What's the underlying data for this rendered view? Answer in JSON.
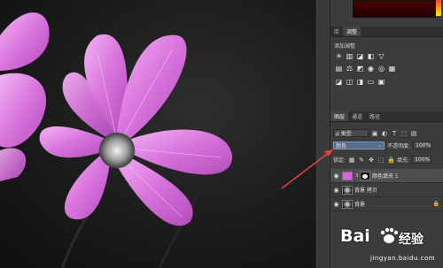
{
  "adjustments_panel": {
    "tabs": [
      "库",
      "调整"
    ],
    "active_tab": "调整",
    "title": "添加调整"
  },
  "layers_panel": {
    "tabs": [
      "图层",
      "通道",
      "路径"
    ],
    "active_tab": "图层",
    "kind_filter": "ρ 类型",
    "blend_mode": "颜色",
    "opacity_label": "不透明度:",
    "opacity_value": "100%",
    "lock_label": "锁定:",
    "fill_label": "填充:",
    "fill_value": "100%",
    "layers": [
      {
        "name": "颜色填充 1",
        "type": "fill",
        "selected": true
      },
      {
        "name": "背景 拷贝",
        "type": "photo-mask",
        "selected": false
      },
      {
        "name": "背景",
        "type": "photo",
        "selected": false
      }
    ]
  },
  "colors": {
    "fill_color": "#e15be6",
    "arrow": "#e0443c",
    "highlight": "#5a6b86"
  },
  "watermark": {
    "logo": "Bai",
    "logo_tail": "经验",
    "url": "jingyan.baidu.com"
  }
}
